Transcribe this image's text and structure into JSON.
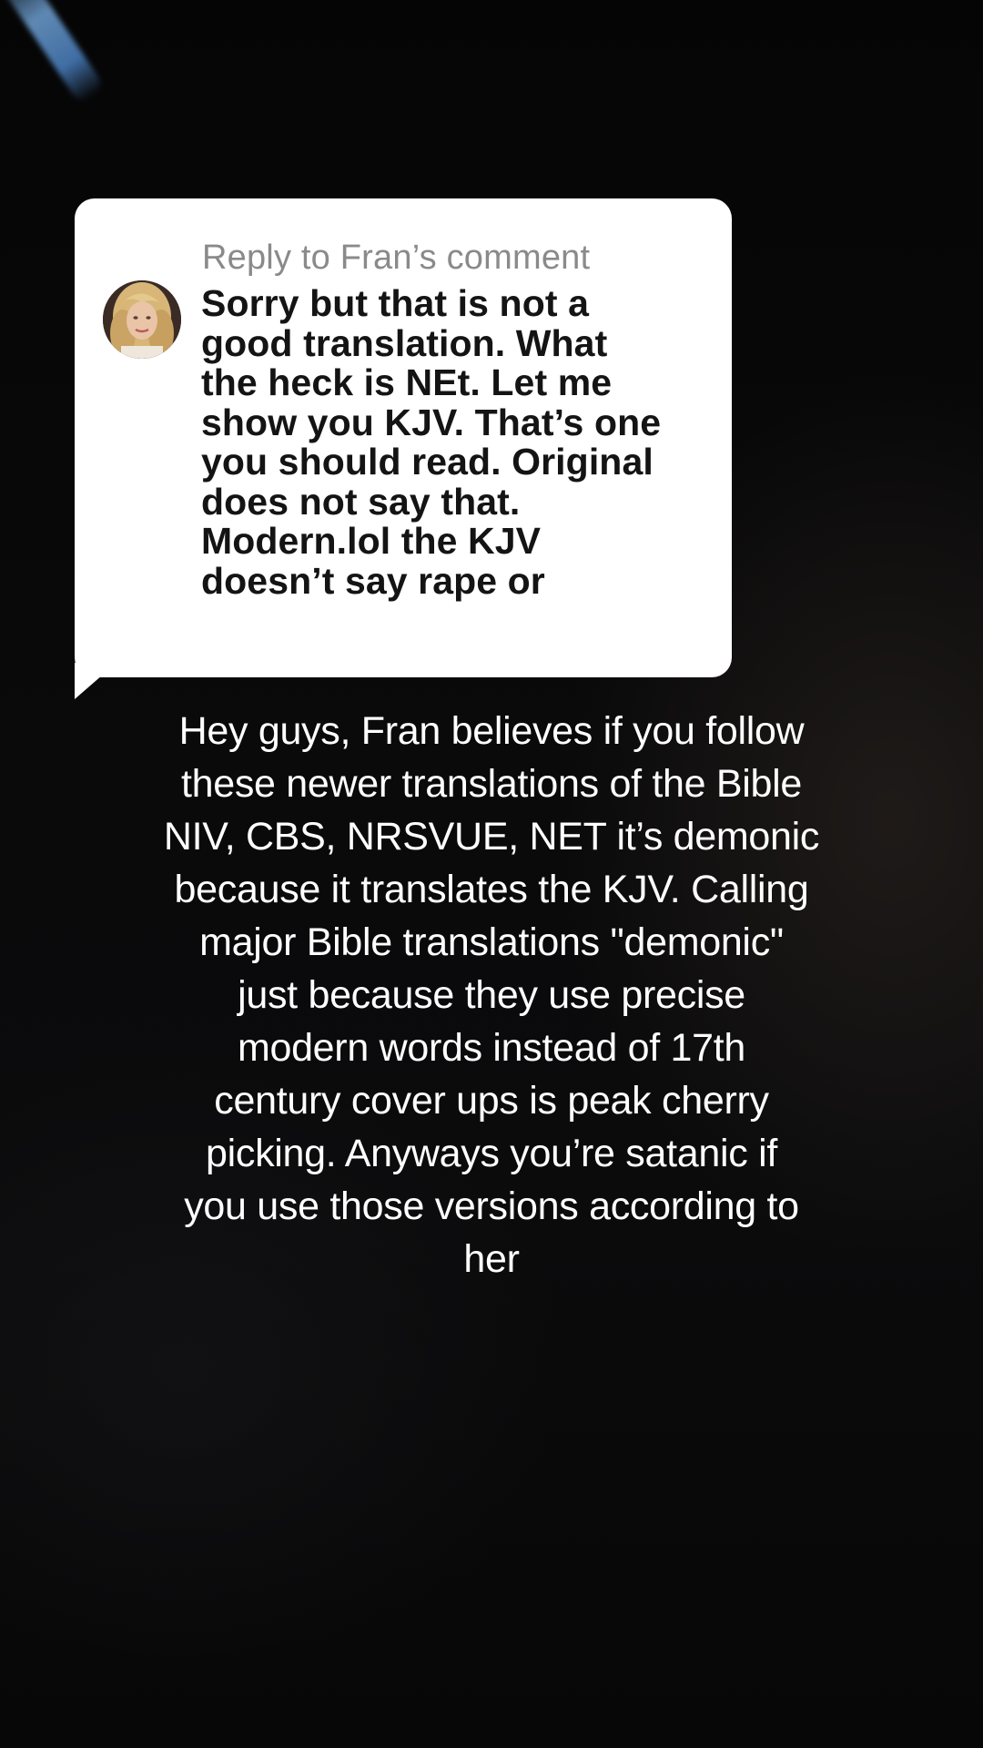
{
  "reply": {
    "label": "Reply to Fran’s comment",
    "avatar_icon": "profile-photo-woman-blonde",
    "comment_lines": [
      "Sorry but that is not a",
      "good translation. What",
      "the heck is NEt. Let me",
      "show you KJV. That’s one",
      "you should read. Original",
      "does not say that.",
      "Modern.lol the KJV",
      "doesn’t say rape or"
    ]
  },
  "caption": {
    "lines": [
      "Hey guys, Fran believes if you follow",
      "these newer translations of the Bible",
      "NIV, CBS, NRSVUE, NET it’s demonic",
      "because it translates the KJV. Calling",
      "major Bible translations \"demonic\"",
      "just because they use precise",
      "modern words instead of 17th",
      "century cover ups is peak cherry",
      "picking. Anyways you’re satanic if",
      "you use those versions according to",
      "her"
    ]
  },
  "colors": {
    "background": "#070707",
    "card": "#ffffff",
    "reply_label": "#8a8a8a",
    "comment_text": "#141414",
    "caption_text": "#ffffff",
    "streak": "#6ea0d2"
  }
}
